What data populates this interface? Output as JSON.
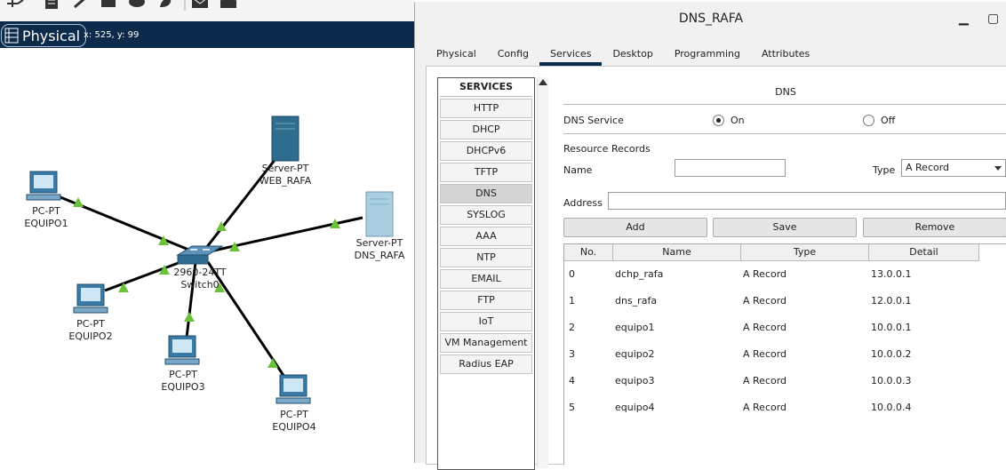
{
  "workspace": {
    "mode_label": "Physical",
    "coords": "x: 525, y: 99"
  },
  "devices": [
    {
      "type": "PC-PT",
      "name": "EQUIPO1"
    },
    {
      "type": "PC-PT",
      "name": "EQUIPO2"
    },
    {
      "type": "PC-PT",
      "name": "EQUIPO3"
    },
    {
      "type": "PC-PT",
      "name": "EQUIPO4"
    },
    {
      "type": "Server-PT",
      "name": "WEB_RAFA"
    },
    {
      "type": "Server-PT",
      "name": "DNS_RAFA"
    },
    {
      "type": "2960-24TT",
      "name": "Switch0"
    }
  ],
  "dialog": {
    "title": "DNS_RAFA",
    "minimize_symbol": "▁",
    "maximize_symbol": "▢",
    "tabs": [
      "Physical",
      "Config",
      "Services",
      "Desktop",
      "Programming",
      "Attributes"
    ],
    "active_tab": "Services"
  },
  "services": {
    "header": "SERVICES",
    "items": [
      "HTTP",
      "DHCP",
      "DHCPv6",
      "TFTP",
      "DNS",
      "SYSLOG",
      "AAA",
      "NTP",
      "EMAIL",
      "FTP",
      "IoT",
      "VM Management",
      "Radius EAP"
    ],
    "selected": "DNS"
  },
  "dns": {
    "heading": "DNS",
    "service_label": "DNS Service",
    "on_label": "On",
    "off_label": "Off",
    "state": "On",
    "resource_records_label": "Resource Records",
    "name_label": "Name",
    "name_value": "",
    "type_label": "Type",
    "type_value": "A Record",
    "address_label": "Address",
    "address_value": "",
    "add_label": "Add",
    "save_label": "Save",
    "remove_label": "Remove",
    "columns": [
      "No.",
      "Name",
      "Type",
      "Detail"
    ],
    "records": [
      {
        "no": "0",
        "name": "dchp_rafa",
        "type": "A Record",
        "detail": "13.0.0.1"
      },
      {
        "no": "1",
        "name": "dns_rafa",
        "type": "A Record",
        "detail": "12.0.0.1"
      },
      {
        "no": "2",
        "name": "equipo1",
        "type": "A Record",
        "detail": "10.0.0.1"
      },
      {
        "no": "3",
        "name": "equipo2",
        "type": "A Record",
        "detail": "10.0.0.2"
      },
      {
        "no": "4",
        "name": "equipo3",
        "type": "A Record",
        "detail": "10.0.0.3"
      },
      {
        "no": "5",
        "name": "equipo4",
        "type": "A Record",
        "detail": "10.0.0.4"
      }
    ]
  },
  "colors": {
    "header_bar": "#0c2a4a",
    "link_up": "#6ac13a",
    "pc_blue": "#3a7aa6",
    "server_dark": "#2e6d8e",
    "server_light": "#a9cfe0"
  }
}
